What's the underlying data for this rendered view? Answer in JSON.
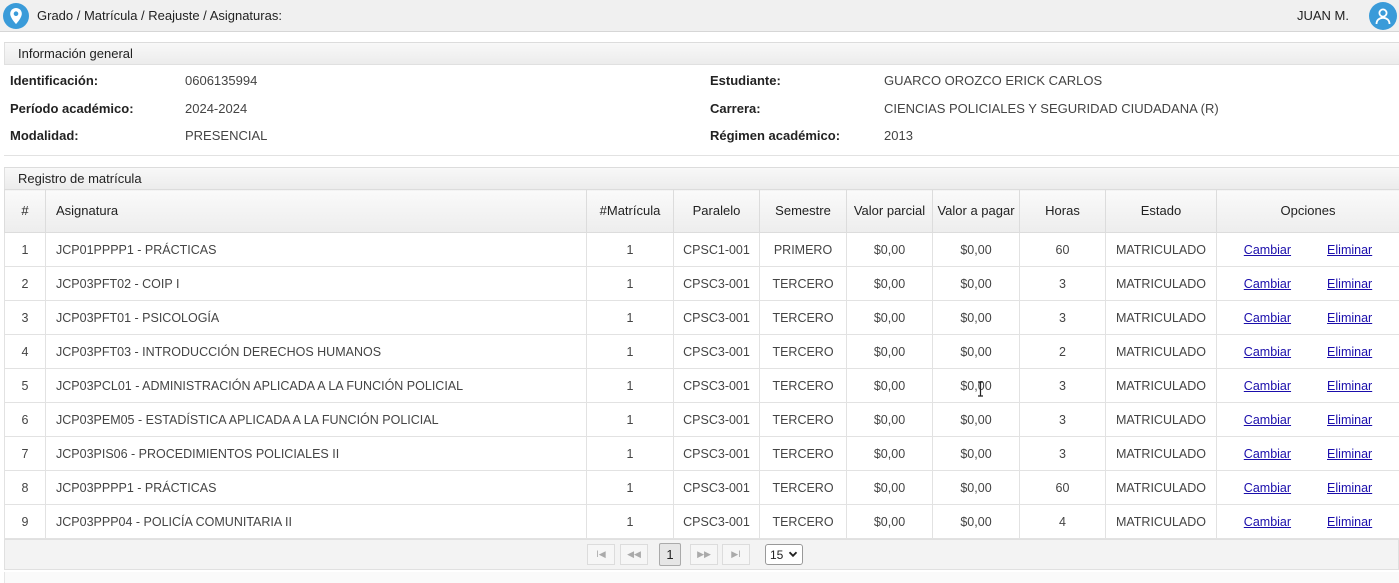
{
  "header": {
    "breadcrumb": "Grado / Matrícula / Reajuste / Asignaturas:",
    "user_name": "JUAN M.",
    "location_icon": "map-pin-icon",
    "avatar_icon": "user-icon",
    "accent_color": "#3a9bd9"
  },
  "info": {
    "title": "Información general",
    "fields": [
      {
        "label": "Identificación:",
        "value": "0606135994"
      },
      {
        "label": "Período académico:",
        "value": "2024-2024"
      },
      {
        "label": "Modalidad:",
        "value": "PRESENCIAL"
      },
      {
        "label": "Estudiante:",
        "value": "GUARCO OROZCO ERICK CARLOS"
      },
      {
        "label": "Carrera:",
        "value": "CIENCIAS POLICIALES Y SEGURIDAD CIUDADANA (R)"
      },
      {
        "label": "Régimen académico:",
        "value": "2013"
      }
    ]
  },
  "registro": {
    "title": "Registro de matrícula",
    "columns": [
      "#",
      "Asignatura",
      "#Matrícula",
      "Paralelo",
      "Semestre",
      "Valor parcial",
      "Valor a pagar",
      "Horas",
      "Estado",
      "Opciones"
    ],
    "rows": [
      {
        "n": "1",
        "asignatura": "JCP01PPPP1 - PRÁCTICAS",
        "matricula": "1",
        "paralelo": "CPSC1-001",
        "semestre": "PRIMERO",
        "valor_parcial": "$0,00",
        "valor_pagar": "$0,00",
        "horas": "60",
        "estado": "MATRICULADO"
      },
      {
        "n": "2",
        "asignatura": "JCP03PFT02 - COIP I",
        "matricula": "1",
        "paralelo": "CPSC3-001",
        "semestre": "TERCERO",
        "valor_parcial": "$0,00",
        "valor_pagar": "$0,00",
        "horas": "3",
        "estado": "MATRICULADO"
      },
      {
        "n": "3",
        "asignatura": "JCP03PFT01 - PSICOLOGÍA",
        "matricula": "1",
        "paralelo": "CPSC3-001",
        "semestre": "TERCERO",
        "valor_parcial": "$0,00",
        "valor_pagar": "$0,00",
        "horas": "3",
        "estado": "MATRICULADO"
      },
      {
        "n": "4",
        "asignatura": "JCP03PFT03 - INTRODUCCIÓN DERECHOS HUMANOS",
        "matricula": "1",
        "paralelo": "CPSC3-001",
        "semestre": "TERCERO",
        "valor_parcial": "$0,00",
        "valor_pagar": "$0,00",
        "horas": "2",
        "estado": "MATRICULADO"
      },
      {
        "n": "5",
        "asignatura": "JCP03PCL01 - ADMINISTRACIÓN APLICADA A LA FUNCIÓN POLICIAL",
        "matricula": "1",
        "paralelo": "CPSC3-001",
        "semestre": "TERCERO",
        "valor_parcial": "$0,00",
        "valor_pagar": "$0,00",
        "horas": "3",
        "estado": "MATRICULADO"
      },
      {
        "n": "6",
        "asignatura": "JCP03PEM05 - ESTADÍSTICA APLICADA A LA FUNCIÓN POLICIAL",
        "matricula": "1",
        "paralelo": "CPSC3-001",
        "semestre": "TERCERO",
        "valor_parcial": "$0,00",
        "valor_pagar": "$0,00",
        "horas": "3",
        "estado": "MATRICULADO"
      },
      {
        "n": "7",
        "asignatura": "JCP03PIS06 - PROCEDIMIENTOS POLICIALES II",
        "matricula": "1",
        "paralelo": "CPSC3-001",
        "semestre": "TERCERO",
        "valor_parcial": "$0,00",
        "valor_pagar": "$0,00",
        "horas": "3",
        "estado": "MATRICULADO"
      },
      {
        "n": "8",
        "asignatura": "JCP03PPPP1 - PRÁCTICAS",
        "matricula": "1",
        "paralelo": "CPSC3-001",
        "semestre": "TERCERO",
        "valor_parcial": "$0,00",
        "valor_pagar": "$0,00",
        "horas": "60",
        "estado": "MATRICULADO"
      },
      {
        "n": "9",
        "asignatura": "JCP03PPP04 - POLICÍA COMUNITARIA II",
        "matricula": "1",
        "paralelo": "CPSC3-001",
        "semestre": "TERCERO",
        "valor_parcial": "$0,00",
        "valor_pagar": "$0,00",
        "horas": "4",
        "estado": "MATRICULADO"
      }
    ],
    "actions": {
      "change": "Cambiar",
      "delete": "Eliminar"
    }
  },
  "pager": {
    "first": "I◀",
    "prev": "◀◀",
    "current": "1",
    "next": "▶▶",
    "last": "▶I",
    "page_size": "15"
  }
}
